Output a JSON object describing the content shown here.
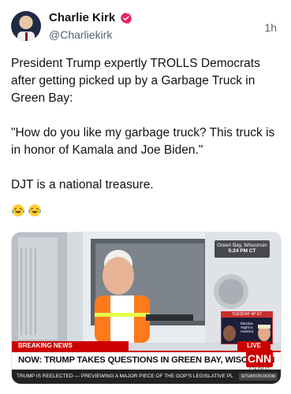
{
  "post": {
    "author_name": "Charlie Kirk",
    "author_handle": "@Charliekirk",
    "time": "1h",
    "text": "President Trump expertly TROLLS Democrats after getting picked up by a Garbage Truck in Green Bay:\n\n\"How do you like my garbage truck? This truck is in honor of Kamala and Joe Biden.\"\n\nDJT is a national treasure.",
    "emoji": [
      "laughing-with-tears",
      "laughing-with-tears"
    ]
  },
  "media": {
    "bug_location": "Green Bay, Wisconsin",
    "bug_time": "5:24 PM CT",
    "election_header": "TUESDAY 4P ET",
    "election_text": "Election Night in America",
    "breaking": "BREAKING NEWS",
    "live": "LIVE",
    "headline": "NOW: TRUMP TAKES QUESTIONS IN GREEN BAY, WISCONSIN",
    "network": "CNN",
    "network_time": "6:24 PM ET",
    "ticker": "TRUMP IS REELECTED — PREVIEWING A MAJOR PIECE OF THE GOP'S LEGISLATIVE PL",
    "ticker_badge": "SITUATION ROOM"
  },
  "colors": {
    "verified_badge": "#e0245e",
    "cnn_red": "#cc0000",
    "text_secondary": "#536471"
  }
}
